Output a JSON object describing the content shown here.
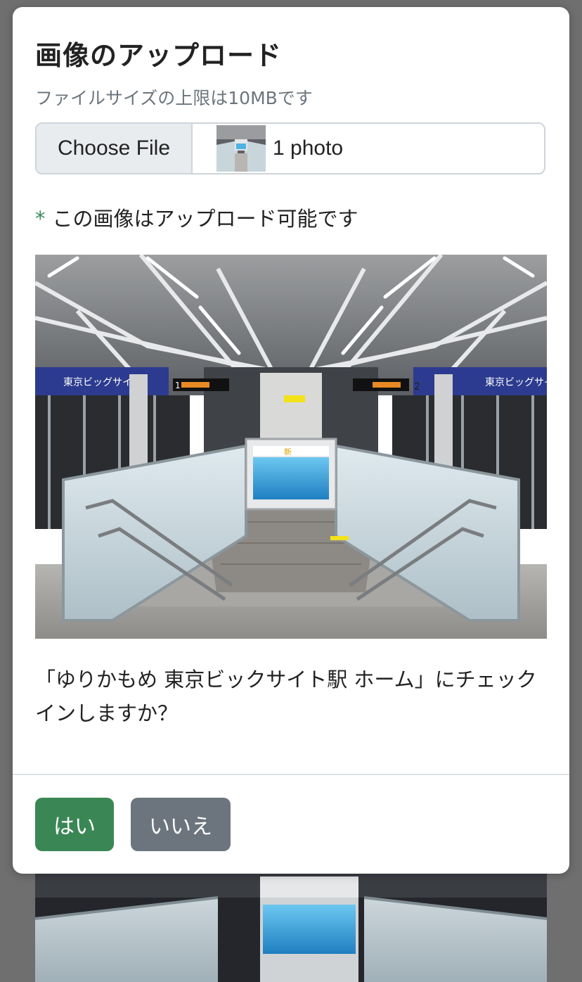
{
  "modal": {
    "title": "画像のアップロード",
    "size_note": "ファイルサイズの上限は10MBです",
    "file_input": {
      "button_label": "Choose File",
      "selection_text": "1 photo"
    },
    "status": {
      "marker": "*",
      "text": "この画像はアップロード可能です"
    },
    "question": "「ゆりかもめ 東京ビックサイト駅 ホーム」にチェックインしますか？",
    "buttons": {
      "yes": "はい",
      "no": "いいえ"
    }
  },
  "photo_signs": {
    "station_name": "東京ビッグサイト",
    "track_left": "1",
    "track_right": "2",
    "board_title": "新"
  },
  "colors": {
    "success": "#3a8755",
    "secondary": "#6c757d",
    "muted_text": "#6c757d"
  }
}
